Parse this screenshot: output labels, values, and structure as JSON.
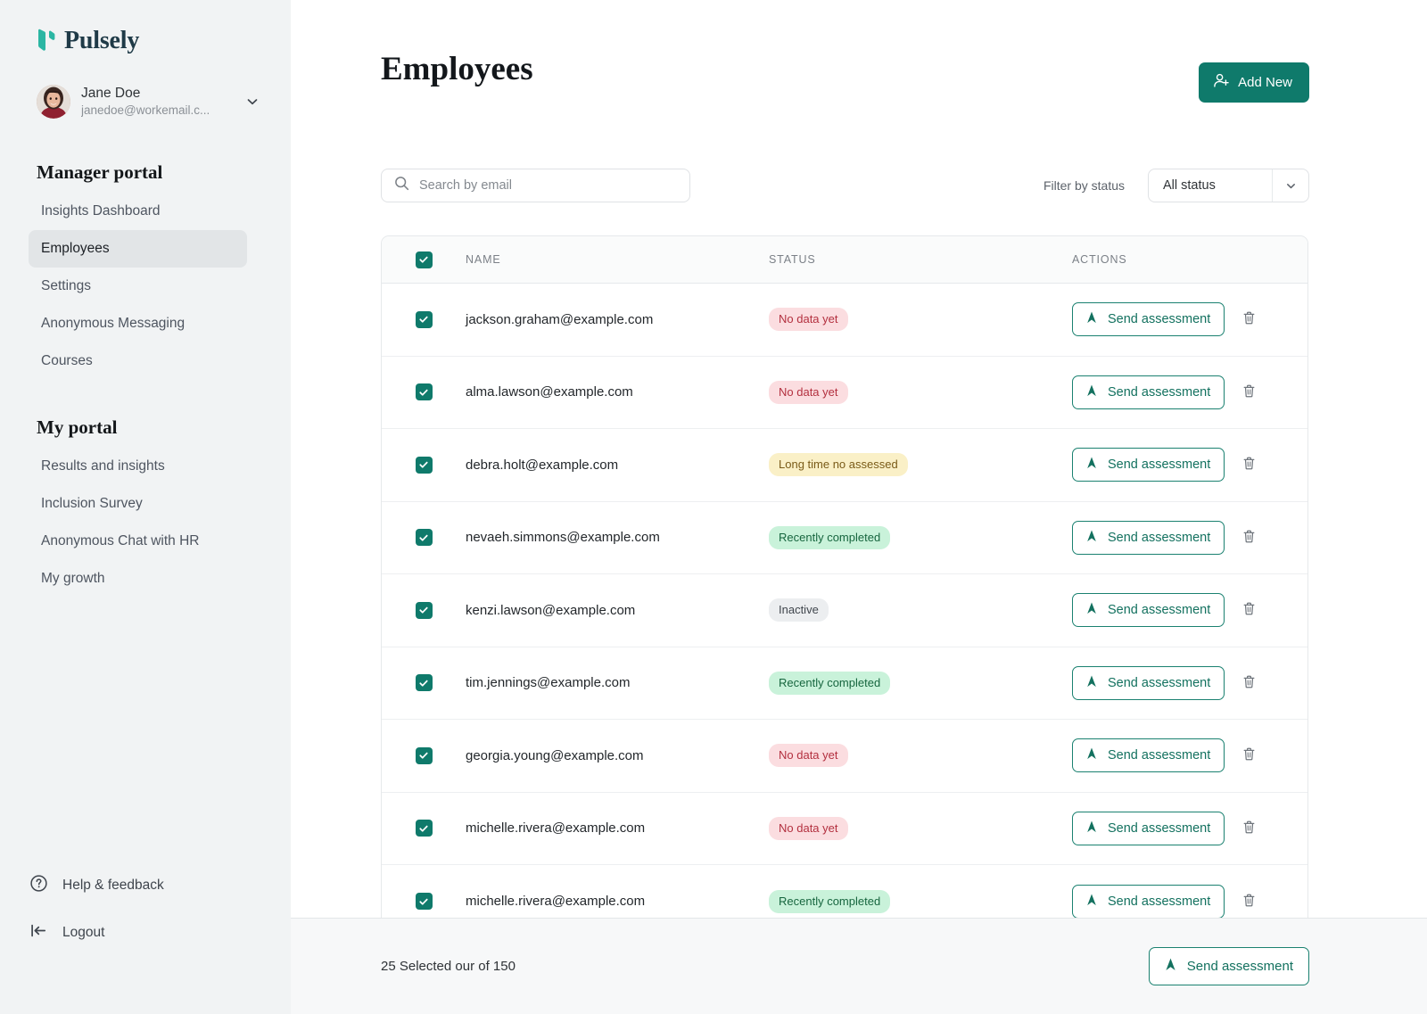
{
  "brand": {
    "name": "Pulsely",
    "logo_icon": "pulsely-leaf-logo",
    "accent": "#0f7a6b",
    "wordmark_color": "#1f3a47"
  },
  "user": {
    "name": "Jane Doe",
    "email": "janedoe@workemail.c...",
    "avatar_icon": "user-avatar",
    "chevron_icon": "chevron-down-icon"
  },
  "sidebar": {
    "sections": [
      {
        "heading": "Manager portal",
        "items": [
          {
            "label": "Insights Dashboard",
            "active": false
          },
          {
            "label": "Employees",
            "active": true
          },
          {
            "label": "Settings",
            "active": false
          },
          {
            "label": "Anonymous Messaging",
            "active": false
          },
          {
            "label": "Courses",
            "active": false
          }
        ]
      },
      {
        "heading": "My portal",
        "items": [
          {
            "label": "Results and insights",
            "active": false
          },
          {
            "label": "Inclusion Survey",
            "active": false
          },
          {
            "label": "Anonymous Chat with HR",
            "active": false
          },
          {
            "label": "My growth",
            "active": false
          }
        ]
      }
    ],
    "bottom": [
      {
        "label": "Help & feedback",
        "icon": "question-circle-icon"
      },
      {
        "label": "Logout",
        "icon": "logout-arrow-icon"
      }
    ]
  },
  "header": {
    "title": "Employees",
    "add_button": "Add New",
    "add_icon": "user-plus-icon"
  },
  "search": {
    "placeholder": "Search by email",
    "value": "",
    "icon": "search-icon"
  },
  "filter": {
    "label": "Filter by status",
    "selected": "All status",
    "chevron_icon": "chevron-down-icon"
  },
  "table": {
    "select_all_checked": true,
    "columns": [
      "NAME",
      "STATUS",
      "ACTIONS"
    ],
    "action_label": "Send assessment",
    "action_icon": "send-icon",
    "delete_icon": "trash-icon",
    "rows": [
      {
        "checked": true,
        "email": "jackson.graham@example.com",
        "status": "No data yet",
        "status_tone": "red"
      },
      {
        "checked": true,
        "email": "alma.lawson@example.com",
        "status": "No data yet",
        "status_tone": "red"
      },
      {
        "checked": true,
        "email": "debra.holt@example.com",
        "status": "Long time no assessed",
        "status_tone": "amber"
      },
      {
        "checked": true,
        "email": "nevaeh.simmons@example.com",
        "status": "Recently completed",
        "status_tone": "green"
      },
      {
        "checked": true,
        "email": "kenzi.lawson@example.com",
        "status": "Inactive",
        "status_tone": "gray"
      },
      {
        "checked": true,
        "email": "tim.jennings@example.com",
        "status": "Recently completed",
        "status_tone": "green"
      },
      {
        "checked": true,
        "email": "georgia.young@example.com",
        "status": "No data yet",
        "status_tone": "red"
      },
      {
        "checked": true,
        "email": "michelle.rivera@example.com",
        "status": "No data yet",
        "status_tone": "red"
      },
      {
        "checked": true,
        "email": "michelle.rivera@example.com",
        "status": "Recently completed",
        "status_tone": "green"
      }
    ]
  },
  "footer": {
    "selection_text": "25 Selected our of 150",
    "button_label": "Send assessment",
    "button_icon": "send-icon"
  }
}
